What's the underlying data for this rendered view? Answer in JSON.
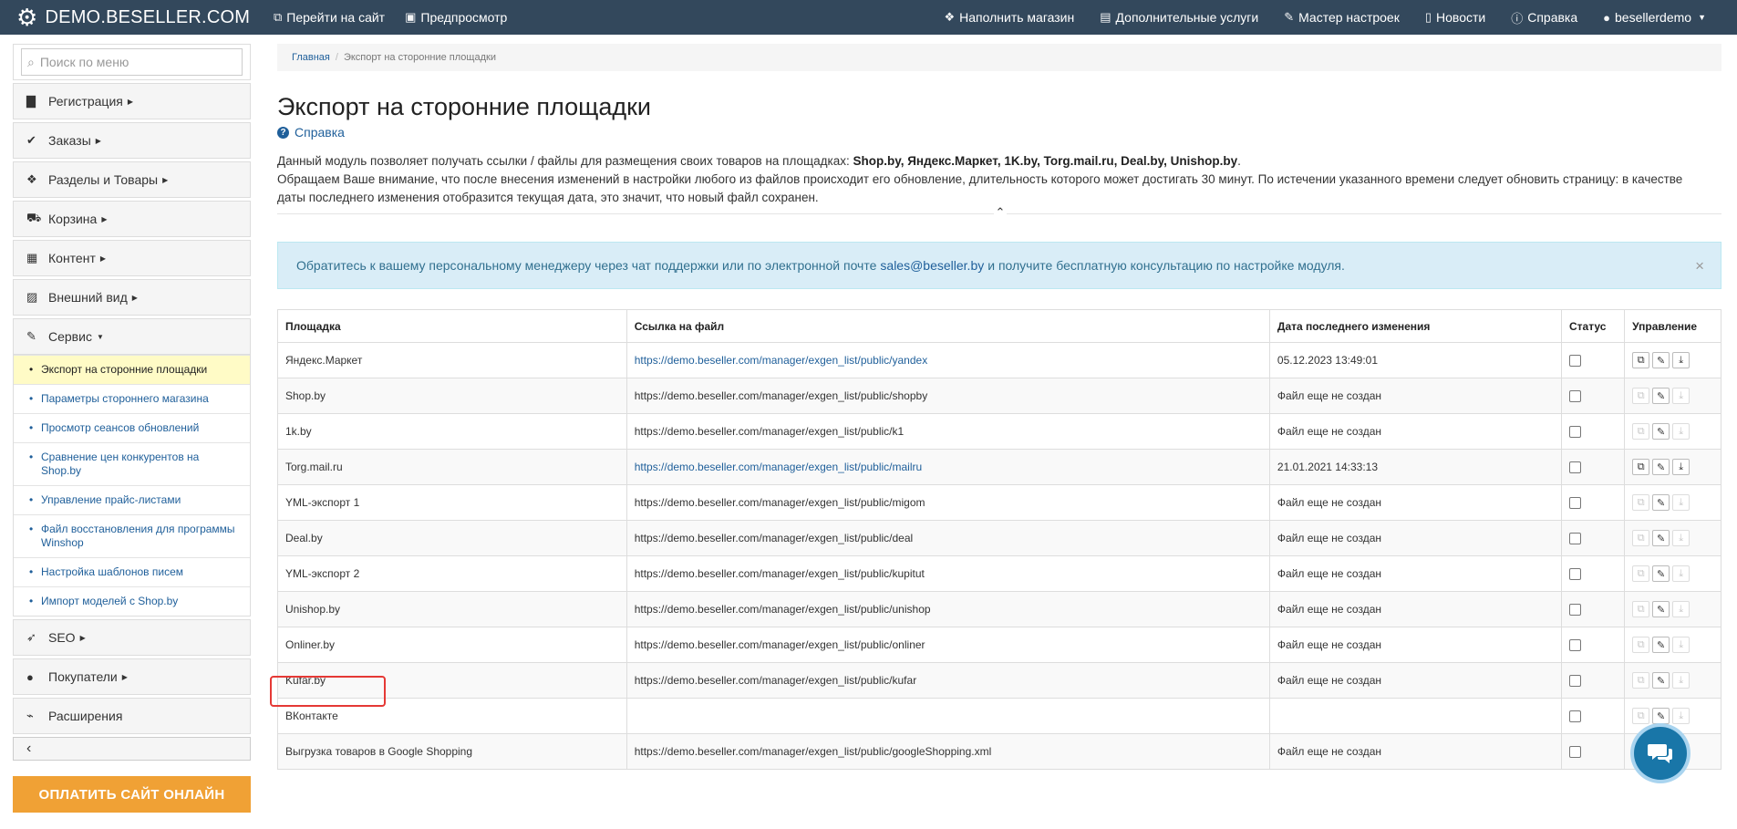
{
  "navbar": {
    "brand": "DEMO.BESELLER.COM",
    "go_to_site": "Перейти на сайт",
    "preview": "Предпросмотр",
    "fill_store": "Наполнить магазин",
    "extra_services": "Дополнительные услуги",
    "setup_wizard": "Мастер настроек",
    "news": "Новости",
    "help": "Справка",
    "user": "besellerdemo"
  },
  "sidebar": {
    "search_placeholder": "Поиск по меню",
    "items": [
      {
        "label": "Регистрация",
        "icon": "briefcase-icon"
      },
      {
        "label": "Заказы",
        "icon": "check-circle-icon"
      },
      {
        "label": "Разделы и Товары",
        "icon": "cubes-icon"
      },
      {
        "label": "Корзина",
        "icon": "cart-icon"
      },
      {
        "label": "Контент",
        "icon": "grid-icon"
      },
      {
        "label": "Внешний вид",
        "icon": "picture-icon"
      },
      {
        "label": "Сервис",
        "icon": "wrench-icon"
      }
    ],
    "service_subitems": [
      "Экспорт на сторонние площадки",
      "Параметры стороннего магазина",
      "Просмотр сеансов обновлений",
      "Сравнение цен конкурентов на Shop.by",
      "Управление прайс-листами",
      "Файл восстановления для программы Winshop",
      "Настройка шаблонов писем",
      "Импорт моделей с Shop.by"
    ],
    "bottom_items": [
      {
        "label": "SEO",
        "icon": "rocket-icon"
      },
      {
        "label": "Покупатели",
        "icon": "user-icon"
      },
      {
        "label": "Расширения",
        "icon": "plug-icon"
      }
    ],
    "pay_button": "ОПЛАТИТЬ САЙТ ОНЛАЙН"
  },
  "breadcrumb": {
    "home": "Главная",
    "current": "Экспорт на сторонние площадки"
  },
  "page": {
    "title": "Экспорт на сторонние площадки",
    "help": "Справка",
    "desc_prefix": "Данный модуль позволяет получать ссылки / файлы для размещения своих товаров на площадках: ",
    "desc_sites": "Shop.by, Яндекс.Маркет, 1K.by, Torg.mail.ru, Deal.by, Unishop.by",
    "desc_suffix": ".",
    "desc_note": "Обращаем Ваше внимание, что после внесения изменений в настройки любого из файлов происходит его обновление, длительность которого может достигать 30 минут. По истечении указанного времени следует обновить страницу: в качестве даты последнего изменения отобразится текущая дата, это значит, что новый файл сохранен."
  },
  "alert": {
    "prefix": "Обратитесь к вашему персональному менеджеру через чат поддержки или по электронной почте",
    "email": "sales@beseller.by",
    "suffix": "и получите бесплатную консультацию по настройке модуля.",
    "close": "×"
  },
  "table": {
    "headers": [
      "Площадка",
      "Ссылка на файл",
      "Дата последнего изменения",
      "Статус",
      "Управление"
    ],
    "rows": [
      {
        "platform": "Яндекс.Маркет",
        "link": "https://demo.beseller.com/manager/exgen_list/public/yandex",
        "date": "05.12.2023 13:49:01",
        "active": true
      },
      {
        "platform": "Shop.by",
        "link": "https://demo.beseller.com/manager/exgen_list/public/shopby",
        "date": "Файл еще не создан",
        "active": false
      },
      {
        "platform": "1k.by",
        "link": "https://demo.beseller.com/manager/exgen_list/public/k1",
        "date": "Файл еще не создан",
        "active": false
      },
      {
        "platform": "Torg.mail.ru",
        "link": "https://demo.beseller.com/manager/exgen_list/public/mailru",
        "date": "21.01.2021 14:33:13",
        "active": true
      },
      {
        "platform": "YML-экспорт 1",
        "link": "https://demo.beseller.com/manager/exgen_list/public/migom",
        "date": "Файл еще не создан",
        "active": false
      },
      {
        "platform": "Deal.by",
        "link": "https://demo.beseller.com/manager/exgen_list/public/deal",
        "date": "Файл еще не создан",
        "active": false
      },
      {
        "platform": "YML-экспорт 2",
        "link": "https://demo.beseller.com/manager/exgen_list/public/kupitut",
        "date": "Файл еще не создан",
        "active": false
      },
      {
        "platform": "Unishop.by",
        "link": "https://demo.beseller.com/manager/exgen_list/public/unishop",
        "date": "Файл еще не создан",
        "active": false
      },
      {
        "platform": "Onliner.by",
        "link": "https://demo.beseller.com/manager/exgen_list/public/onliner",
        "date": "Файл еще не создан",
        "active": false
      },
      {
        "platform": "Kufar.by",
        "link": "https://demo.beseller.com/manager/exgen_list/public/kufar",
        "date": "Файл еще не создан",
        "active": false
      },
      {
        "platform": "ВКонтакте",
        "link": "",
        "date": "",
        "active": false
      },
      {
        "platform": "Выгрузка товаров в Google Shopping",
        "link": "https://demo.beseller.com/manager/exgen_list/public/googleShopping.xml",
        "date": "Файл еще не создан",
        "active": false
      }
    ]
  },
  "colors": {
    "navbar": "#33485c",
    "link": "#1f5f9a",
    "highlight": "#e53935",
    "pay": "#f0a135"
  }
}
